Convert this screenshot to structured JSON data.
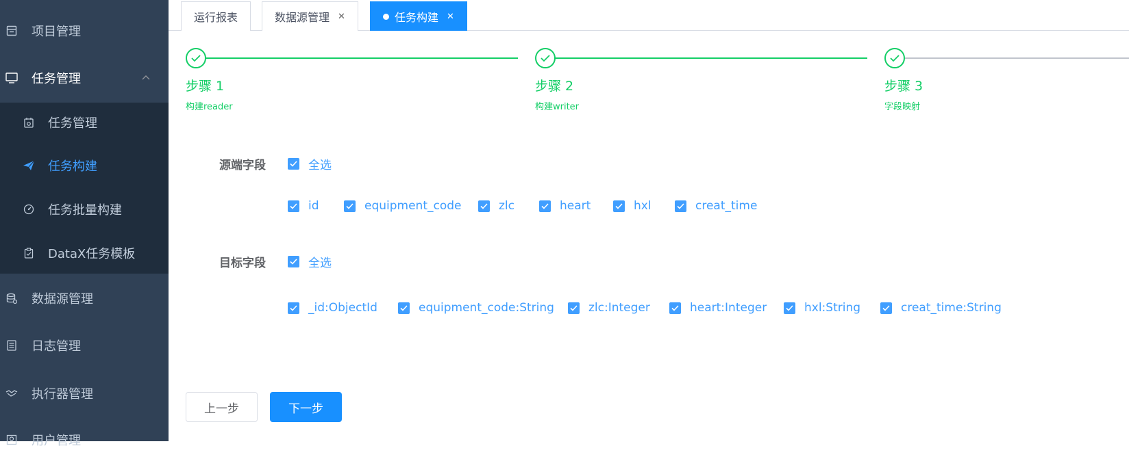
{
  "sidebar": {
    "items": [
      {
        "label": "项目管理",
        "icon": "table-icon"
      },
      {
        "label": "任务管理",
        "icon": "monitor-icon"
      },
      {
        "label": "数据源管理",
        "icon": "database-icon"
      },
      {
        "label": "日志管理",
        "icon": "document-icon"
      },
      {
        "label": "执行器管理",
        "icon": "handshake-icon"
      },
      {
        "label": "用户管理",
        "icon": "user-icon"
      }
    ],
    "subitems": [
      {
        "label": "任务管理",
        "icon": "calendar-icon"
      },
      {
        "label": "任务构建",
        "icon": "paper-plane-icon"
      },
      {
        "label": "任务批量构建",
        "icon": "dashboard-icon"
      },
      {
        "label": "DataX任务模板",
        "icon": "clipboard-icon"
      }
    ]
  },
  "tabs": [
    {
      "label": "运行报表"
    },
    {
      "label": "数据源管理"
    },
    {
      "label": "任务构建"
    }
  ],
  "steps": [
    {
      "title": "步骤 1",
      "desc": "构建reader"
    },
    {
      "title": "步骤 2",
      "desc": "构建writer"
    },
    {
      "title": "步骤 3",
      "desc": "字段映射"
    }
  ],
  "source": {
    "label": "源端字段",
    "select_all": "全选",
    "fields": [
      "id",
      "equipment_code",
      "zlc",
      "heart",
      "hxl",
      "creat_time"
    ]
  },
  "target": {
    "label": "目标字段",
    "select_all": "全选",
    "fields": [
      "_id:ObjectId",
      "equipment_code:String",
      "zlc:Integer",
      "heart:Integer",
      "hxl:String",
      "creat_time:String"
    ]
  },
  "buttons": {
    "prev": "上一步",
    "next": "下一步"
  },
  "colors": {
    "sidebar": "#304156",
    "submenu": "#1f2d3d",
    "accent": "#1890ff",
    "success": "#13ce66"
  }
}
